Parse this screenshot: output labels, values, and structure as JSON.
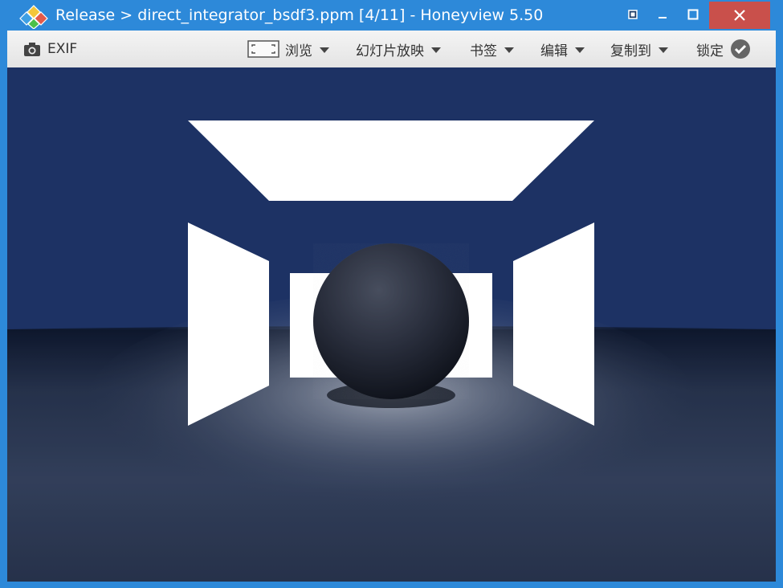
{
  "window": {
    "title": "Release > direct_integrator_bsdf3.ppm [4/11] - Honeyview 5.50",
    "accent_color": "#2d89d9",
    "close_color": "#c9504b"
  },
  "toolbar": {
    "exif_label": "EXIF",
    "browse_label": "浏览",
    "slideshow_label": "幻灯片放映",
    "bookmark_label": "书签",
    "edit_label": "编辑",
    "copy_to_label": "复制到",
    "lock_label": "锁定"
  },
  "icons": {
    "app": "honeyview-diamond-icon",
    "exif": "camera-icon",
    "browse": "fit-screen-icon",
    "lock": "check-circle-icon"
  },
  "image": {
    "description_colors": {
      "background": "#1d3264",
      "floor": "#3a4a6a",
      "light_panels": "#ffffff",
      "sphere": "#2a3040"
    }
  }
}
